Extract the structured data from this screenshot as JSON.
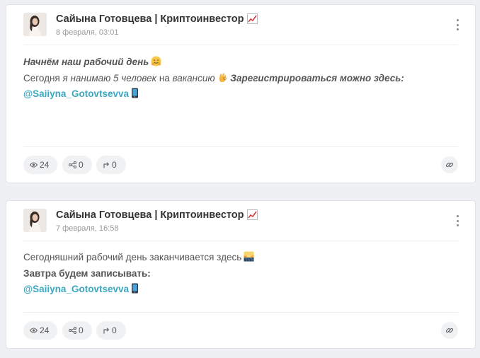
{
  "posts": [
    {
      "author": "Сайына Готовцева | Криптоинвестор",
      "date": "8 февраля, 03:01",
      "lines": {
        "l1": "Начнём наш рабочий день",
        "l2_a": "Сегодня ",
        "l2_b": "я нанимаю 5 человек",
        "l2_c": " на ",
        "l2_d": "вакансию",
        "l2_e": "Зарегистрироваться можно здесь:",
        "l3_link": "@Saiiyna_Gotovtsevva"
      },
      "stats": {
        "views": "24",
        "shares": "0",
        "reposts": "0"
      }
    },
    {
      "author": "Сайына Готовцева | Криптоинвестор",
      "date": "7 февраля, 16:58",
      "lines": {
        "l1": "Сегодняшний рабочий день заканчивается здесь",
        "l2": "Завтра будем записывать:",
        "l3_link": "@Saiiyna_Gotovtsevva"
      },
      "stats": {
        "views": "24",
        "shares": "0",
        "reposts": "0"
      }
    }
  ],
  "icons": {
    "author_badge": "chart-increasing-icon",
    "menu": "more-vertical-icon",
    "views": "eye-icon",
    "shares": "share-icon",
    "reposts": "repost-icon",
    "link": "link-icon",
    "emoji_hug": "hugging-face-icon",
    "emoji_ok": "ok-hand-icon",
    "emoji_phone": "mobile-phone-icon",
    "emoji_sunset": "sunset-icon"
  },
  "colors": {
    "link": "#3aa8c1",
    "background": "#eef0f3"
  }
}
